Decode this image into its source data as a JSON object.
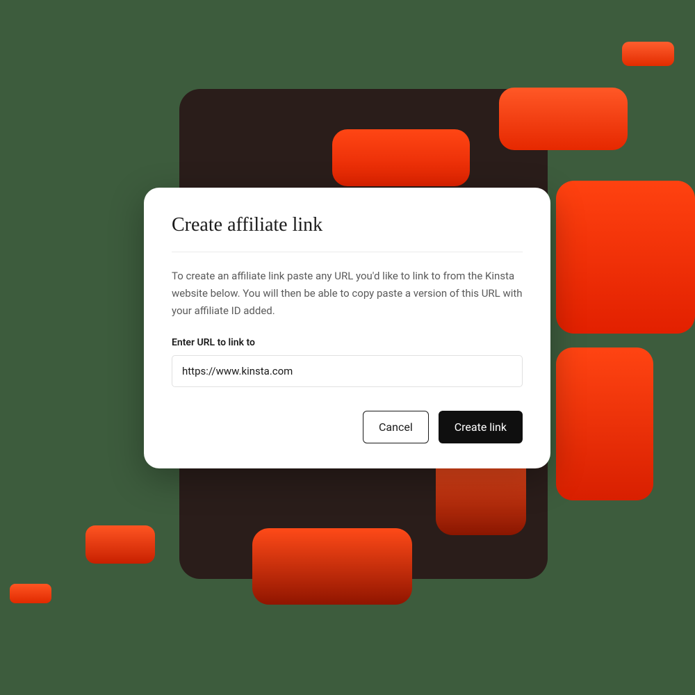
{
  "modal": {
    "title": "Create affiliate link",
    "description": "To create an affiliate link paste any URL you'd like to link to from the Kinsta website below. You will then be able to copy paste a version of this URL with your affiliate ID added.",
    "input_label": "Enter URL to link to",
    "input_value": "https://www.kinsta.com",
    "cancel_label": "Cancel",
    "submit_label": "Create link"
  }
}
